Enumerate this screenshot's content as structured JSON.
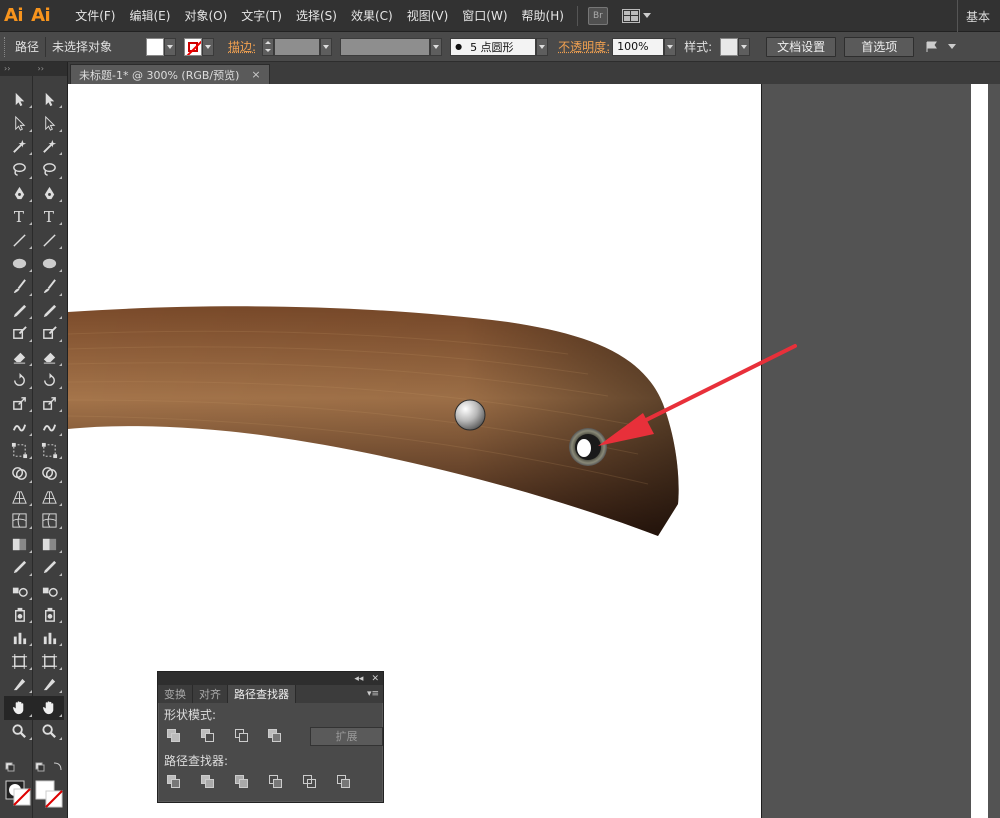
{
  "menubar": {
    "logos": [
      "Ai",
      "Ai"
    ],
    "items": [
      "文件(F)",
      "编辑(E)",
      "对象(O)",
      "文字(T)",
      "选择(S)",
      "效果(C)",
      "视图(V)",
      "窗口(W)",
      "帮助(H)"
    ],
    "bridge_label": "Br",
    "workspace_label": "基本"
  },
  "controlbar": {
    "path_label": "路径",
    "selection_status": "未选择对象",
    "stroke_label": "描边:",
    "brush_dot": "●",
    "brush_label": "5 点圆形",
    "opacity_label": "不透明度:",
    "opacity_value": "100%",
    "style_label": "样式:",
    "doc_setup_button": "文档设置",
    "prefs_button": "首选项"
  },
  "document": {
    "tab_title": "未标题-1* @ 300% (RGB/预览)",
    "close_glyph": "×"
  },
  "toolbox": {
    "header_glyphs": [
      "››",
      "››"
    ],
    "tools": [
      "selection-tool",
      "direct-selection-tool",
      "magic-wand-tool",
      "lasso-tool",
      "pen-tool",
      "type-tool",
      "line-tool",
      "ellipse-tool",
      "paintbrush-tool",
      "pencil-tool",
      "blob-brush-tool",
      "eraser-tool",
      "rotate-tool",
      "scale-tool",
      "warp-tool",
      "free-transform-tool",
      "shape-builder-tool",
      "perspective-grid-tool",
      "mesh-tool",
      "gradient-tool",
      "eyedropper-tool",
      "blend-tool",
      "symbol-sprayer-tool",
      "column-graph-tool",
      "artboard-tool",
      "slice-tool",
      "hand-tool",
      "zoom-tool"
    ],
    "active_tool": "hand-tool"
  },
  "pathfinder_panel": {
    "title_glyphs": [
      "◂◂",
      "✕"
    ],
    "tabs": [
      "变换",
      "对齐",
      "路径查找器"
    ],
    "active_tab": "路径查找器",
    "menu_glyph": "▾≡",
    "shape_modes_label": "形状模式:",
    "expand_button": "扩展",
    "pathfinders_label": "路径查找器:"
  },
  "colors": {
    "accent_orange": "#f7941d",
    "arrow_red": "#e8303a",
    "wood_dark": "#3a1f12",
    "wood_mid": "#7a4a2a",
    "wood_light": "#a4744a"
  }
}
